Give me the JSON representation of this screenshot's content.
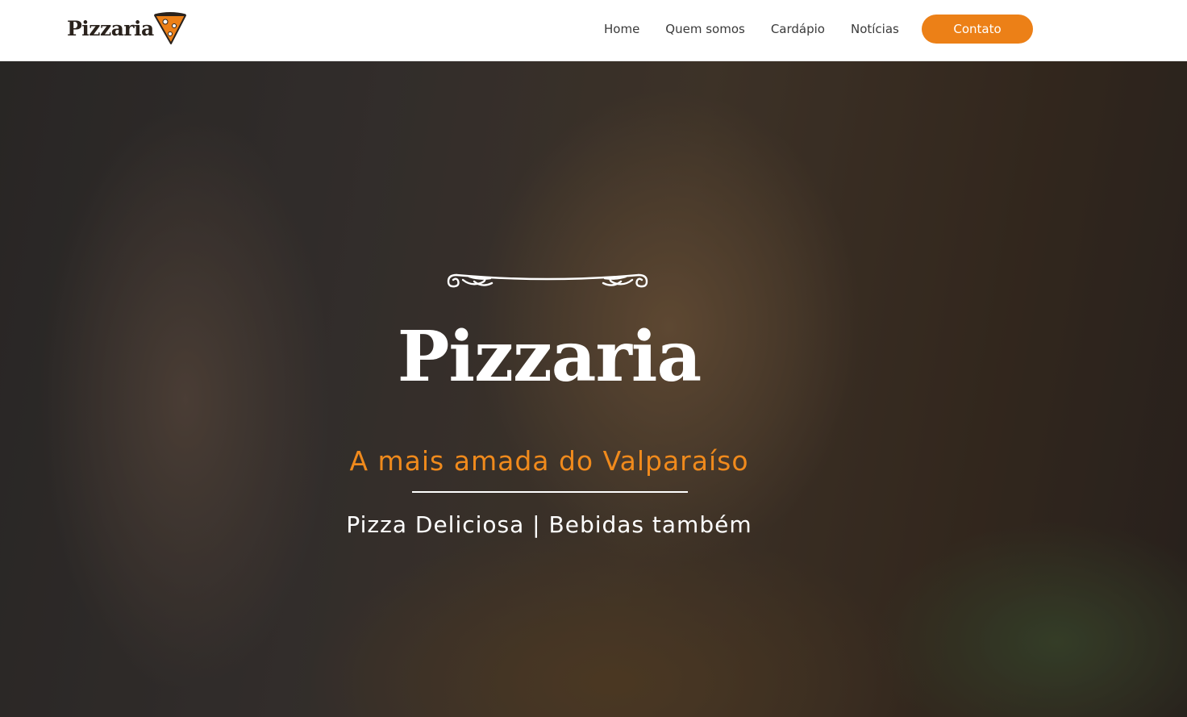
{
  "header": {
    "logo_text": "Pizzaria",
    "logo_icon": "pizza-slice-icon",
    "nav": [
      {
        "label": "Home"
      },
      {
        "label": "Quem somos"
      },
      {
        "label": "Cardápio"
      },
      {
        "label": "Notícias"
      }
    ],
    "contact_label": "Contato"
  },
  "hero": {
    "ornament_icon": "flourish-divider-icon",
    "title": "Pizzaria",
    "subtitle": "A mais amada do Valparaíso",
    "tagline": "Pizza Deliciosa | Bebidas também",
    "background": "cheese-pizza-slice-photo"
  },
  "colors": {
    "accent": "#ec8017",
    "subtitle": "#f08a1c",
    "nav_text": "#3a3a3a",
    "logo_text": "#2a221c"
  }
}
